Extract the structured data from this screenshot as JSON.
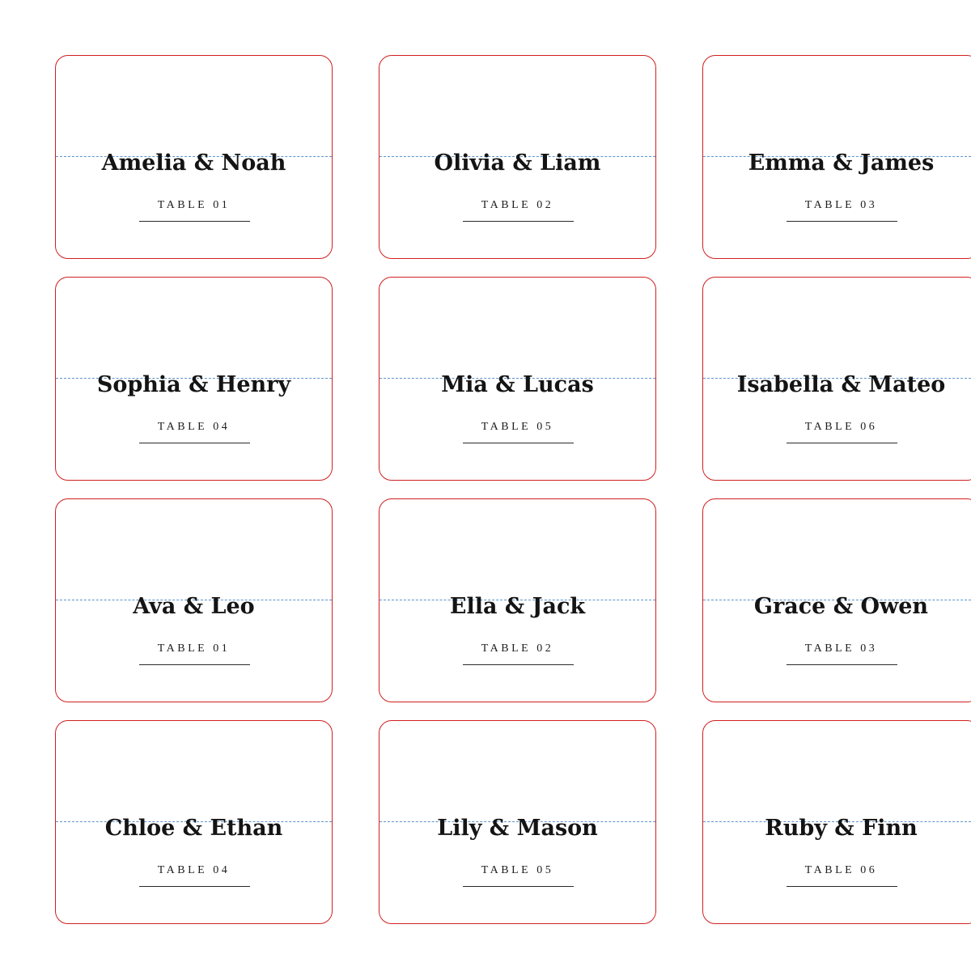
{
  "cards": [
    {
      "names": "Amelia & Noah",
      "table": "TABLE 01"
    },
    {
      "names": "Olivia & Liam",
      "table": "TABLE 02"
    },
    {
      "names": "Emma & James",
      "table": "TABLE 03"
    },
    {
      "names": "Sophia & Henry",
      "table": "TABLE 04"
    },
    {
      "names": "Mia & Lucas",
      "table": "TABLE 05"
    },
    {
      "names": "Isabella & Mateo",
      "table": "TABLE 06"
    },
    {
      "names": "Ava & Leo",
      "table": "TABLE 01"
    },
    {
      "names": "Ella & Jack",
      "table": "TABLE 02"
    },
    {
      "names": "Grace & Owen",
      "table": "TABLE 03"
    },
    {
      "names": "Chloe & Ethan",
      "table": "TABLE 04"
    },
    {
      "names": "Lily & Mason",
      "table": "TABLE 05"
    },
    {
      "names": "Ruby & Finn",
      "table": "TABLE 06"
    }
  ],
  "colors": {
    "cut_line": "#d02020",
    "fold_line": "#5d93c9",
    "text": "#141414"
  }
}
